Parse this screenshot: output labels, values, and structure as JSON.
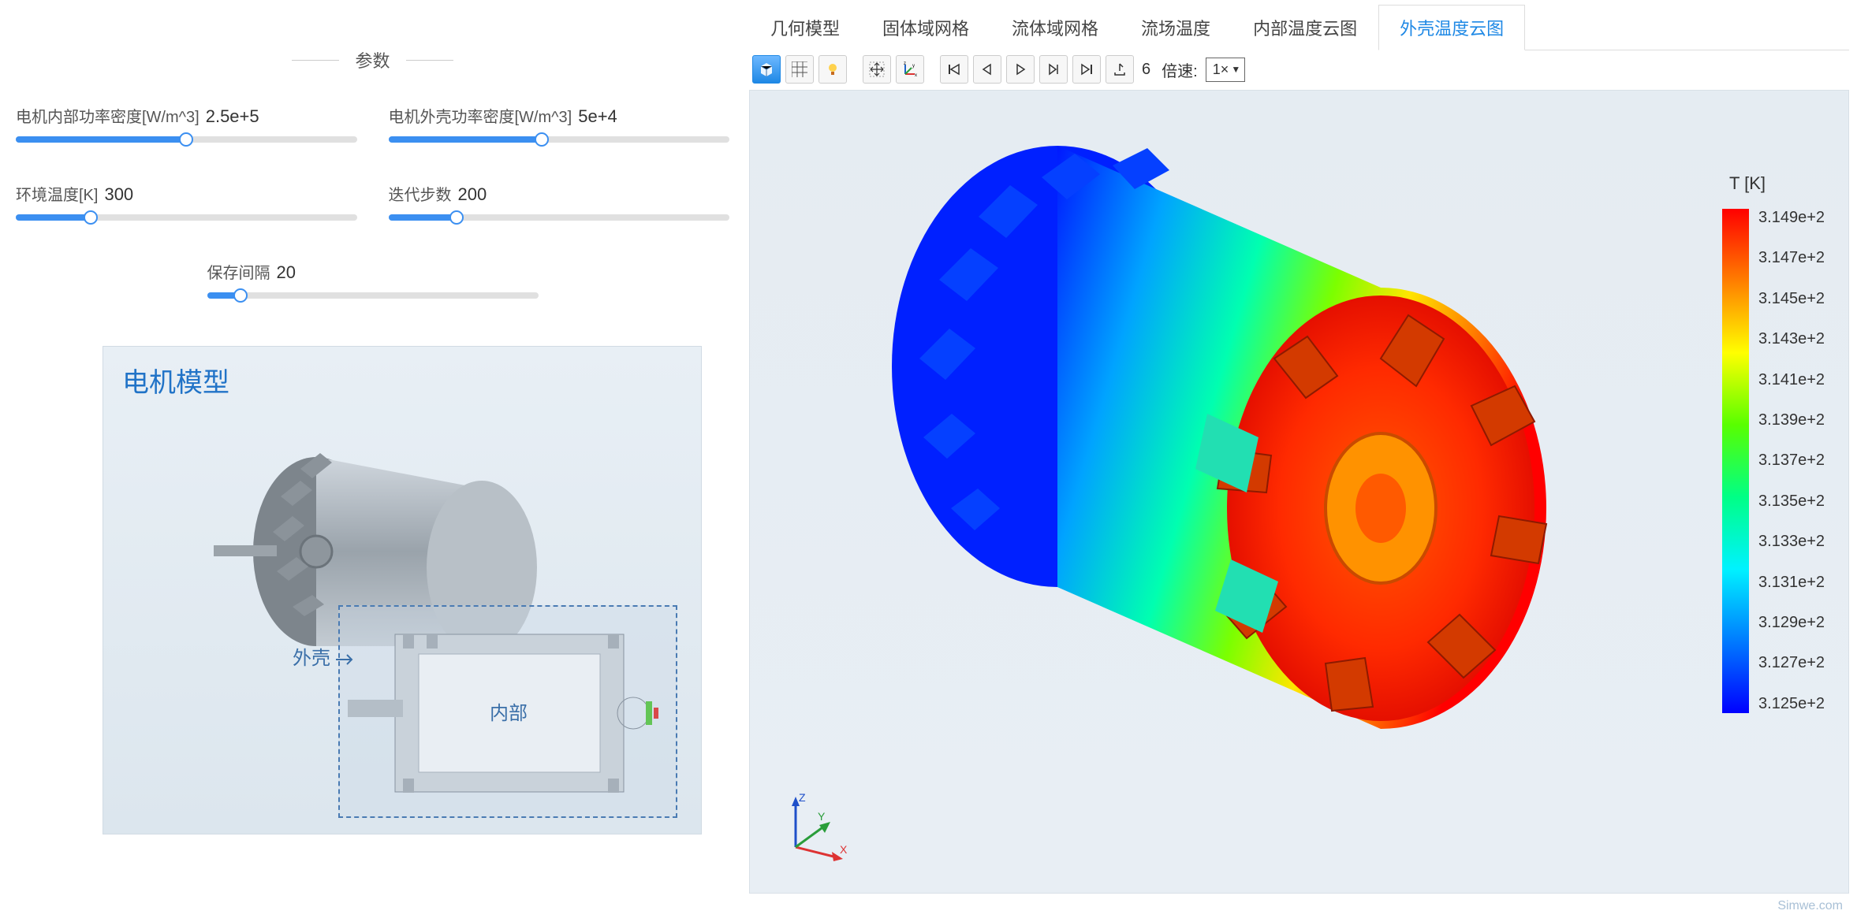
{
  "section_title": "参数",
  "params": {
    "inner_power_density": {
      "label": "电机内部功率密度[W/m^3]",
      "value": "2.5e+5",
      "fill": 0.5
    },
    "outer_power_density": {
      "label": "电机外壳功率密度[W/m^3]",
      "value": "5e+4",
      "fill": 0.45
    },
    "ambient_temp": {
      "label": "环境温度[K]",
      "value": "300",
      "fill": 0.22
    },
    "iterations": {
      "label": "迭代步数",
      "value": "200",
      "fill": 0.2
    },
    "save_interval": {
      "label": "保存间隔",
      "value": "20",
      "fill": 0.1
    }
  },
  "model_box": {
    "title": "电机模型",
    "label_outer": "外壳",
    "label_inner": "内部"
  },
  "tabs": [
    {
      "label": "几何模型"
    },
    {
      "label": "固体域网格"
    },
    {
      "label": "流体域网格"
    },
    {
      "label": "流场温度"
    },
    {
      "label": "内部温度云图"
    },
    {
      "label": "外壳温度云图"
    }
  ],
  "active_tab": 5,
  "toolbar": {
    "frame_number": "6",
    "speed_label": "倍速:",
    "speed_value": "1×"
  },
  "icons": {
    "scene3d": "scene3d",
    "grid": "grid",
    "light": "light",
    "move": "move",
    "axes": "axes",
    "first": "first",
    "prev": "prev",
    "play": "play",
    "next": "next",
    "last": "last",
    "export": "export"
  },
  "legend": {
    "title": "T [K]",
    "ticks": [
      "3.149e+2",
      "3.147e+2",
      "3.145e+2",
      "3.143e+2",
      "3.141e+2",
      "3.139e+2",
      "3.137e+2",
      "3.135e+2",
      "3.133e+2",
      "3.131e+2",
      "3.129e+2",
      "3.127e+2",
      "3.125e+2"
    ]
  },
  "axis_labels": {
    "x": "X",
    "y": "Y",
    "z": "Z"
  },
  "watermark": "Simwe.com"
}
